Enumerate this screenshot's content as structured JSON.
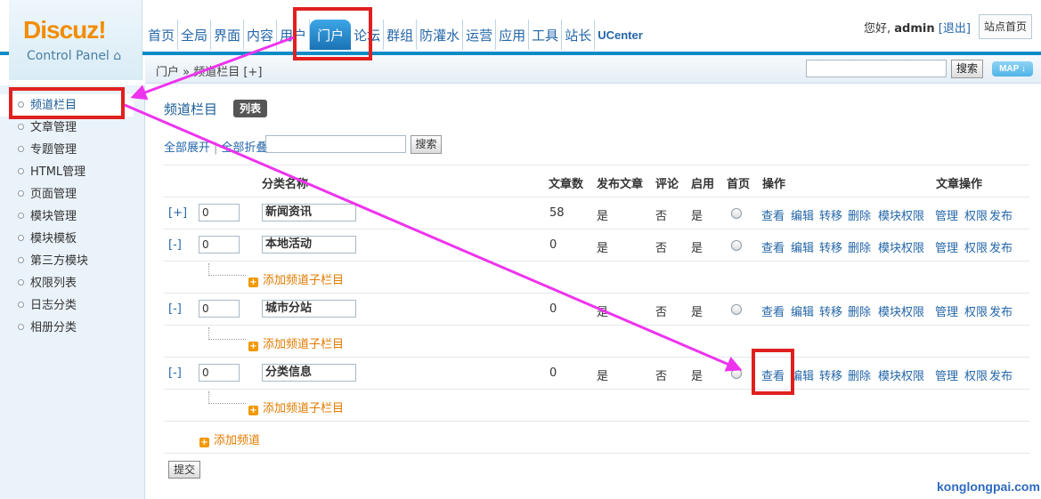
{
  "logo": {
    "brand": "Discuz!",
    "sub": "Control Panel"
  },
  "nav": [
    "首页",
    "全局",
    "界面",
    "内容",
    "用户",
    "门户",
    "论坛",
    "群组",
    "防灌水",
    "运营",
    "应用",
    "工具",
    "站长",
    "UCenter"
  ],
  "nav_active": "门户",
  "user": {
    "greeting": "您好,",
    "name": "admin",
    "logout": "[退出]",
    "site_home": "站点首页"
  },
  "breadcrumb": {
    "text": "门户 » 频道栏目 [+]",
    "search_label": "搜索",
    "map_label": "MAP ↓"
  },
  "sidebar": [
    "频道栏目",
    "文章管理",
    "专题管理",
    "HTML管理",
    "页面管理",
    "模块管理",
    "模块模板",
    "第三方模块",
    "权限列表",
    "日志分类",
    "相册分类"
  ],
  "page": {
    "title": "频道栏目",
    "badge": "列表",
    "expand_all": "全部展开",
    "collapse_all": "全部折叠",
    "search_label": "搜索"
  },
  "table": {
    "headers": [
      "分类名称",
      "文章数",
      "发布文章",
      "评论",
      "启用",
      "首页",
      "操作",
      "文章操作"
    ],
    "rows": [
      {
        "toggle": "[+]",
        "order": "0",
        "name": "新闻资讯",
        "count": "58",
        "publish": "是",
        "comment": "否",
        "enabled": "是"
      },
      {
        "toggle": "[-]",
        "order": "0",
        "name": "本地活动",
        "count": "0",
        "publish": "是",
        "comment": "否",
        "enabled": "是"
      },
      {
        "toggle": "[-]",
        "order": "0",
        "name": "城市分站",
        "count": "0",
        "publish": "是",
        "comment": "否",
        "enabled": "是"
      },
      {
        "toggle": "[-]",
        "order": "0",
        "name": "分类信息",
        "count": "0",
        "publish": "是",
        "comment": "否",
        "enabled": "是"
      }
    ],
    "ops": [
      "查看",
      "编辑",
      "转移",
      "删除",
      "模块权限"
    ],
    "article_ops": [
      "管理",
      "权限",
      "发布"
    ],
    "add_sub": "添加频道子栏目",
    "add_channel": "添加频道"
  },
  "submit_label": "提交",
  "watermark": "konglongpai.com",
  "colors": {
    "accent": "#0b8bc7",
    "annotation": "#e02020",
    "arrow": "#ee33ee"
  }
}
